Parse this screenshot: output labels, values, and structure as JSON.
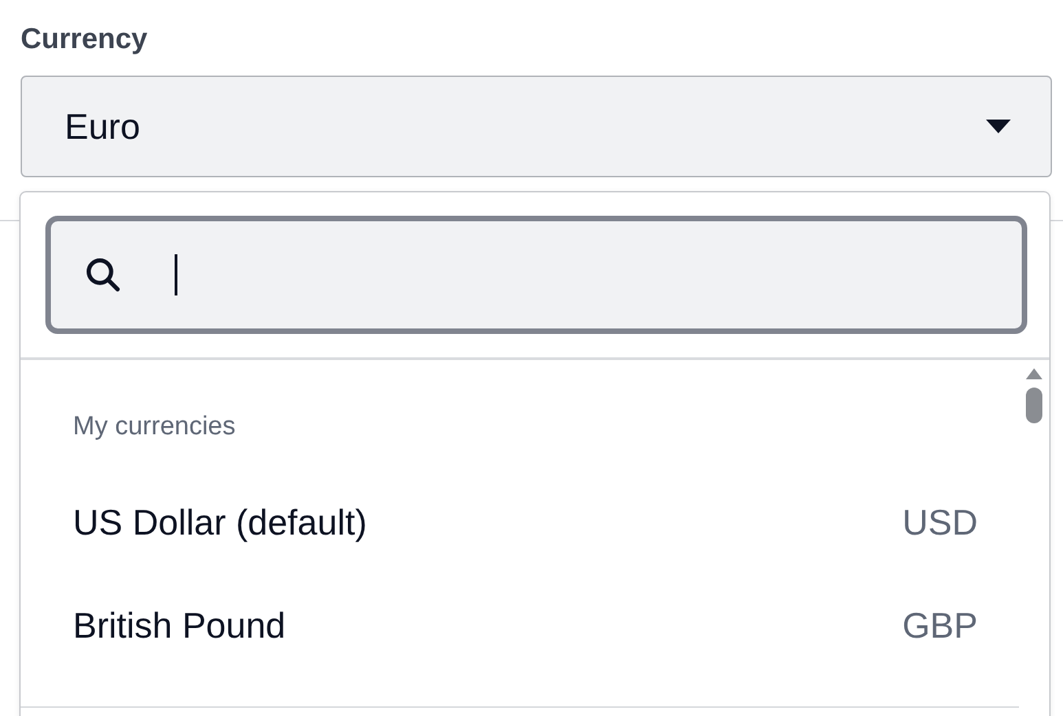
{
  "field": {
    "label": "Currency",
    "value": "Euro",
    "expanded": true
  },
  "dropdown": {
    "sections": [
      {
        "title": "My currencies",
        "items": [
          {
            "name": "US Dollar (default)",
            "code": "USD"
          },
          {
            "name": "British Pound",
            "code": "GBP"
          }
        ]
      }
    ]
  }
}
